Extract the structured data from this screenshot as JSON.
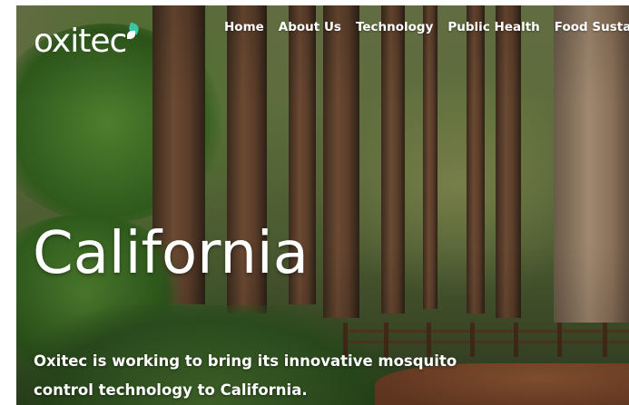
{
  "brand": {
    "name": "oxitec",
    "accent_color": "#39c6a4"
  },
  "nav": {
    "items": [
      {
        "label": "Home"
      },
      {
        "label": "About Us"
      },
      {
        "label": "Technology"
      },
      {
        "label": "Public Health"
      },
      {
        "label": "Food Sustainability"
      }
    ]
  },
  "hero": {
    "title": "California",
    "subtitle": "Oxitec is working to bring its innovative mosquito control technology to California."
  }
}
